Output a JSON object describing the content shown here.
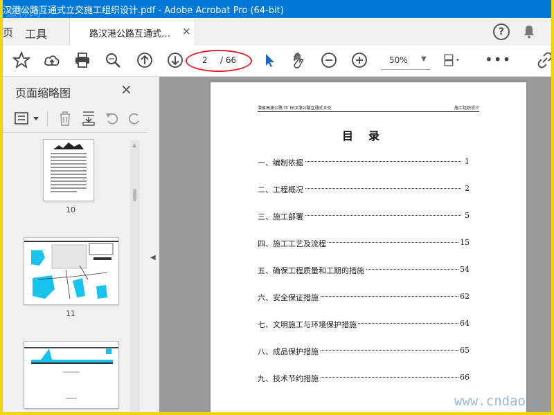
{
  "window": {
    "title": "汉港公路互通式立交施工组织设计.pdf - Adobe Acrobat Pro (64-bit)"
  },
  "watermark_top": "道林网",
  "tabs": {
    "fragment": "页",
    "tools": "工具",
    "document": "路汉港公路互通式…",
    "close": "×"
  },
  "toolbar": {
    "current_page": "2",
    "total_pages": "/ 66",
    "zoom": "50%"
  },
  "sidebar": {
    "title": "页面缩略图",
    "close": "×",
    "thumbnails": [
      {
        "label": "10"
      },
      {
        "label": "11"
      },
      {
        "label": ""
      }
    ]
  },
  "document": {
    "header_left": "潜省高速公路 IV 标汉港公路互通式立交",
    "header_right": "施工组织设计",
    "toc_title": "目录",
    "toc": [
      {
        "title": "一、编制依据",
        "page": "1"
      },
      {
        "title": "二、工程概况",
        "page": "2"
      },
      {
        "title": "三、施工部署",
        "page": "5"
      },
      {
        "title": "四、施工工艺及流程",
        "page": "15"
      },
      {
        "title": "五、确保工程质量和工期的措施",
        "page": "54"
      },
      {
        "title": "六、安全保证措施",
        "page": "62"
      },
      {
        "title": "七、文明施工与环境保护措施",
        "page": "64"
      },
      {
        "title": "八、成品保护措施",
        "page": "65"
      },
      {
        "title": "九、技术节约措施",
        "page": "66"
      }
    ]
  },
  "watermark_bottom": "www.cndao.c",
  "colors": {
    "titlebar": "#0078d7",
    "border": "#f7d400",
    "annotation": "#e0202a",
    "cursor": "#1c66c8",
    "thumbnail_water": "#19c3f0"
  }
}
